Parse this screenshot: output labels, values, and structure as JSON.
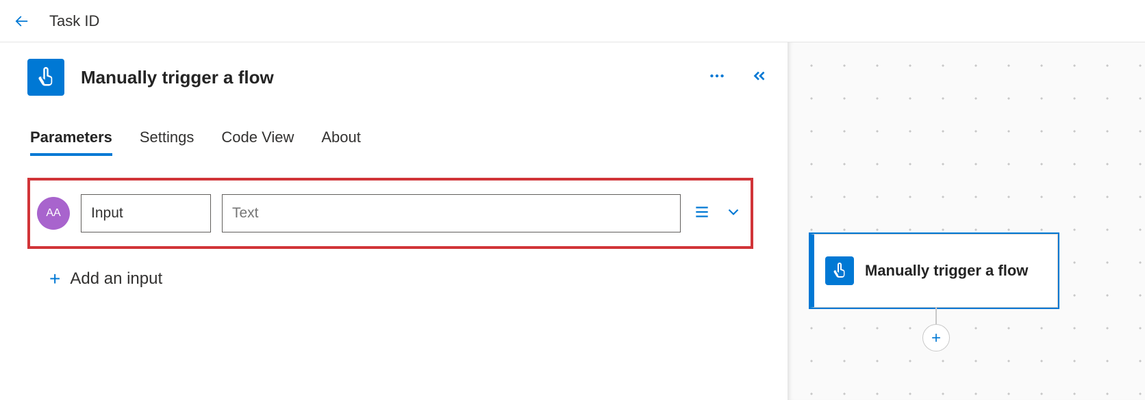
{
  "header": {
    "title": "Task ID"
  },
  "panel": {
    "title": "Manually trigger a flow",
    "tabs": [
      {
        "label": "Parameters",
        "active": true
      },
      {
        "label": "Settings",
        "active": false
      },
      {
        "label": "Code View",
        "active": false
      },
      {
        "label": "About",
        "active": false
      }
    ],
    "input_row": {
      "badge": "AA",
      "name_value": "Input",
      "value_placeholder": "Text"
    },
    "add_input_label": "Add an input"
  },
  "canvas": {
    "card_title": "Manually trigger a flow"
  }
}
